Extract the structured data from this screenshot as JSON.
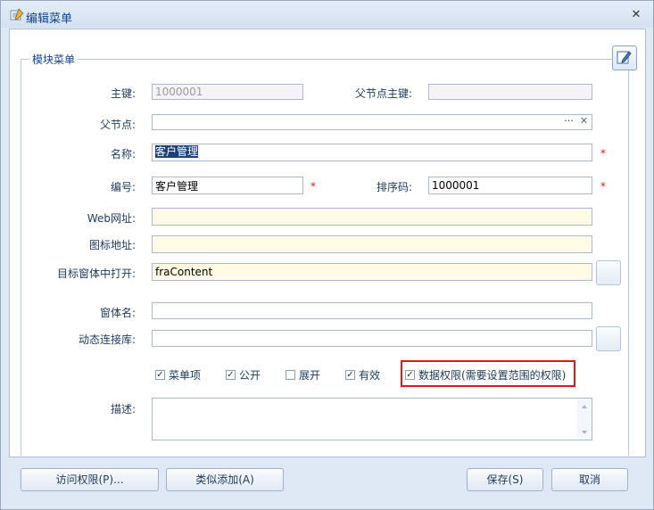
{
  "window": {
    "title": "编辑菜单",
    "close_glyph": "✕"
  },
  "group": {
    "legend": "模块菜单"
  },
  "fields": {
    "primary_key": {
      "label": "主键:",
      "value": "1000001"
    },
    "parent_key": {
      "label": "父节点主键:",
      "value": ""
    },
    "parent_node": {
      "label": "父节点:",
      "value": "",
      "pick_glyph": "···",
      "clear_glyph": "✕"
    },
    "name": {
      "label": "名称:",
      "value": "客户管理",
      "required": "*"
    },
    "code": {
      "label": "编号:",
      "value": "客户管理",
      "required": "*"
    },
    "sort_code": {
      "label": "排序码:",
      "value": "1000001",
      "required": "*"
    },
    "web_url": {
      "label": "Web网址:",
      "value": ""
    },
    "icon_url": {
      "label": "图标地址:",
      "value": ""
    },
    "target_frame": {
      "label": "目标窗体中打开:",
      "value": "fraContent"
    },
    "form_name": {
      "label": "窗体名:",
      "value": ""
    },
    "dynamic_lib": {
      "label": "动态连接库:",
      "value": ""
    },
    "description": {
      "label": "描述:",
      "value": ""
    }
  },
  "checkboxes": [
    {
      "label": "菜单项",
      "checked": true
    },
    {
      "label": "公开",
      "checked": true
    },
    {
      "label": "展开",
      "checked": false
    },
    {
      "label": "有效",
      "checked": true
    },
    {
      "label": "数据权限(需要设置范围的权限)",
      "checked": true
    }
  ],
  "buttons": {
    "access": "访问权限(P)...",
    "similar_add": "类似添加(A)",
    "save": "保存(S)",
    "cancel": "取消"
  },
  "colors": {
    "highlight": "#e01818",
    "required": "#d81e1e",
    "title": "#15428b"
  }
}
